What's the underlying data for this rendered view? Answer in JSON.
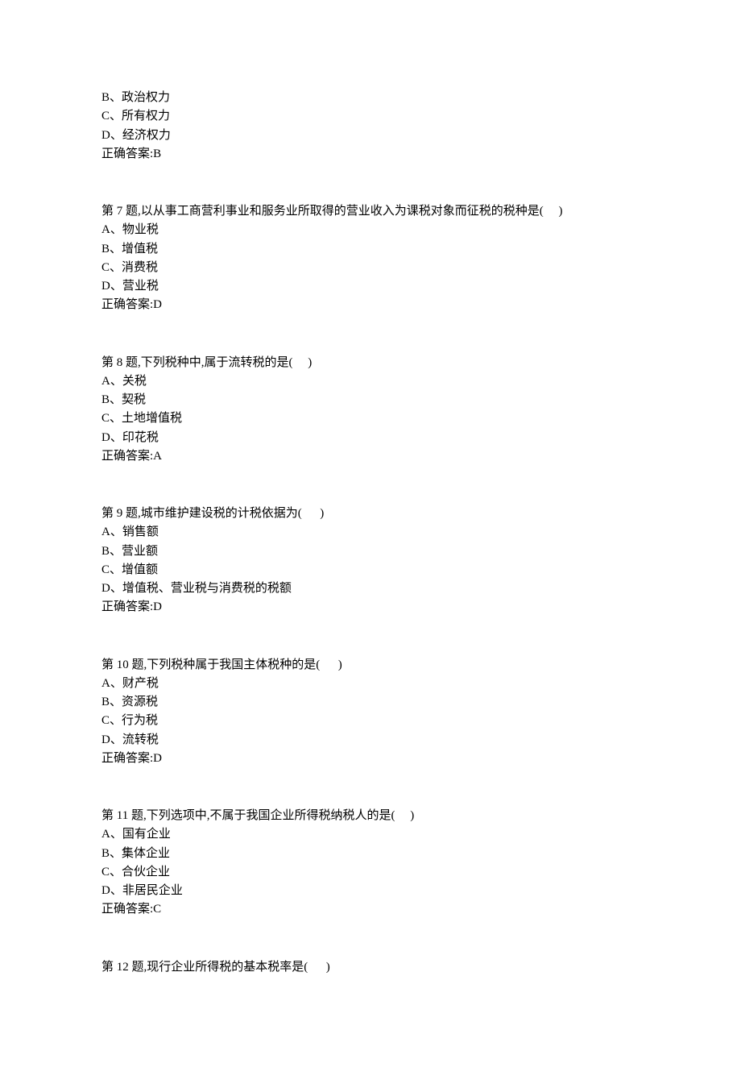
{
  "partial_prev": {
    "options": [
      "B、政治权力",
      "C、所有权力",
      "D、经济权力"
    ],
    "answer": "正确答案:B"
  },
  "questions": [
    {
      "stem": "第 7 题,以从事工商营利事业和服务业所取得的营业收入为课税对象而征税的税种是(     )",
      "options": [
        "A、物业税",
        "B、增值税",
        "C、消费税",
        "D、营业税"
      ],
      "answer": "正确答案:D"
    },
    {
      "stem": "第 8 题,下列税种中,属于流转税的是(     )",
      "options": [
        "A、关税",
        "B、契税",
        "C、土地增值税",
        "D、印花税"
      ],
      "answer": "正确答案:A"
    },
    {
      "stem": "第 9 题,城市维护建设税的计税依据为(      )",
      "options": [
        "A、销售额",
        "B、营业额",
        "C、增值额",
        "D、增值税、营业税与消费税的税额"
      ],
      "answer": "正确答案:D"
    },
    {
      "stem": "第 10 题,下列税种属于我国主体税种的是(      )",
      "options": [
        "A、财产税",
        "B、资源税",
        "C、行为税",
        "D、流转税"
      ],
      "answer": "正确答案:D"
    },
    {
      "stem": "第 11 题,下列选项中,不属于我国企业所得税纳税人的是(     )",
      "options": [
        "A、国有企业",
        "B、集体企业",
        "C、合伙企业",
        "D、非居民企业"
      ],
      "answer": "正确答案:C"
    },
    {
      "stem": "第 12 题,现行企业所得税的基本税率是(      )",
      "options": [],
      "answer": ""
    }
  ]
}
